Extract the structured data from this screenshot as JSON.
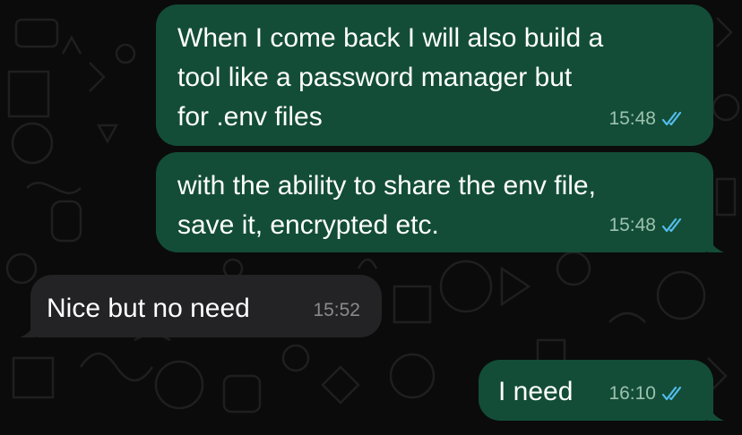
{
  "chat": {
    "messages": [
      {
        "direction": "outgoing",
        "text": "When I come back I will also build a\ntool like a password manager but\nfor .env files",
        "time": "15:48",
        "status": "read",
        "status_icon": "double-check-icon"
      },
      {
        "direction": "outgoing",
        "text": "with the ability to share the env file,\nsave it, encrypted etc.",
        "time": "15:48",
        "status": "read",
        "status_icon": "double-check-icon"
      },
      {
        "direction": "incoming",
        "text": "Nice but no need",
        "time": "15:52"
      },
      {
        "direction": "outgoing",
        "text": "I need",
        "time": "16:10",
        "status": "read",
        "status_icon": "double-check-icon"
      }
    ]
  },
  "colors": {
    "background": "#0b0b0b",
    "outgoing_bubble": "#134d37",
    "incoming_bubble": "#232325",
    "read_ticks": "#53bdeb",
    "text": "#ffffff"
  }
}
